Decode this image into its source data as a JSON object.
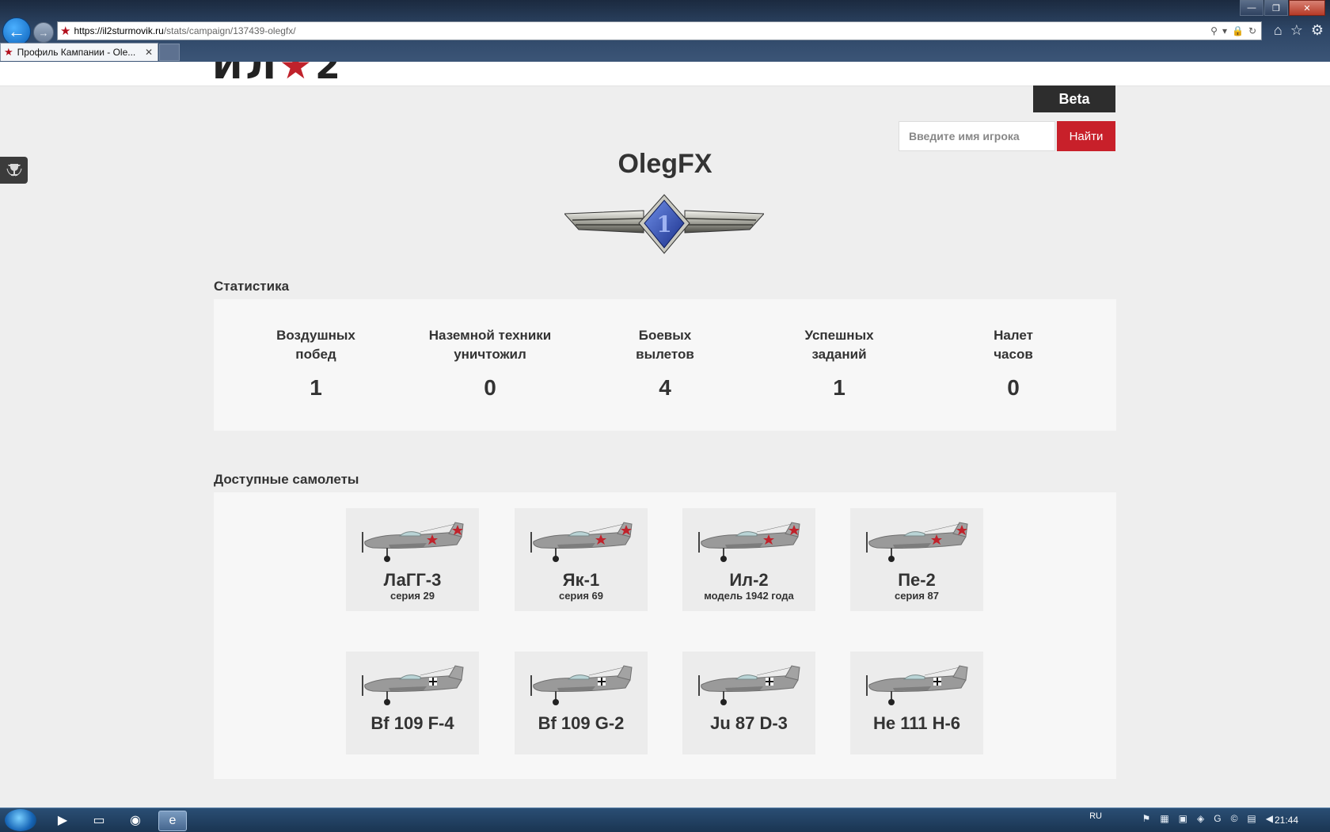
{
  "browser": {
    "url_host": "https://il2sturmovik.ru",
    "url_path": "/stats/campaign/137439-olegfx/",
    "tab_title": "Профиль Кампании - Ole...",
    "tab_close": "✕"
  },
  "header": {
    "logo_left": "ИЛ",
    "logo_star": "★",
    "logo_right": "2",
    "beta_label": "Beta",
    "search_placeholder": "Введите имя игрока",
    "search_button": "Найти"
  },
  "player": {
    "name": "OlegFX",
    "rank_number": "1"
  },
  "stats": {
    "section_title": "Статистика",
    "items": [
      {
        "label_line1": "Воздушных",
        "label_line2": "побед",
        "value": "1"
      },
      {
        "label_line1": "Наземной техники",
        "label_line2": "уничтожил",
        "value": "0"
      },
      {
        "label_line1": "Боевых",
        "label_line2": "вылетов",
        "value": "4"
      },
      {
        "label_line1": "Успешных",
        "label_line2": "заданий",
        "value": "1"
      },
      {
        "label_line1": "Налет",
        "label_line2": "часов",
        "value": "0"
      }
    ]
  },
  "planes": {
    "section_title": "Доступные самолеты",
    "items": [
      {
        "name": "ЛаГГ-3",
        "sub": "серия 29",
        "insignia": "red-star"
      },
      {
        "name": "Як-1",
        "sub": "серия 69",
        "insignia": "red-star"
      },
      {
        "name": "Ил-2",
        "sub": "модель 1942 года",
        "insignia": "red-star"
      },
      {
        "name": "Пе-2",
        "sub": "серия 87",
        "insignia": "red-star"
      },
      {
        "name": "Bf 109 F-4",
        "sub": "",
        "insignia": "balkenkreuz"
      },
      {
        "name": "Bf 109 G-2",
        "sub": "",
        "insignia": "balkenkreuz"
      },
      {
        "name": "Ju 87 D-3",
        "sub": "",
        "insignia": "balkenkreuz"
      },
      {
        "name": "He 111 H-6",
        "sub": "",
        "insignia": "balkenkreuz"
      }
    ]
  },
  "taskbar": {
    "lang": "RU",
    "time": "21:44"
  },
  "colors": {
    "accent_red": "#c8202a",
    "beta_bg": "#2d2d2d",
    "panel_bg": "#f7f7f7",
    "page_bg": "#eeeeee"
  }
}
